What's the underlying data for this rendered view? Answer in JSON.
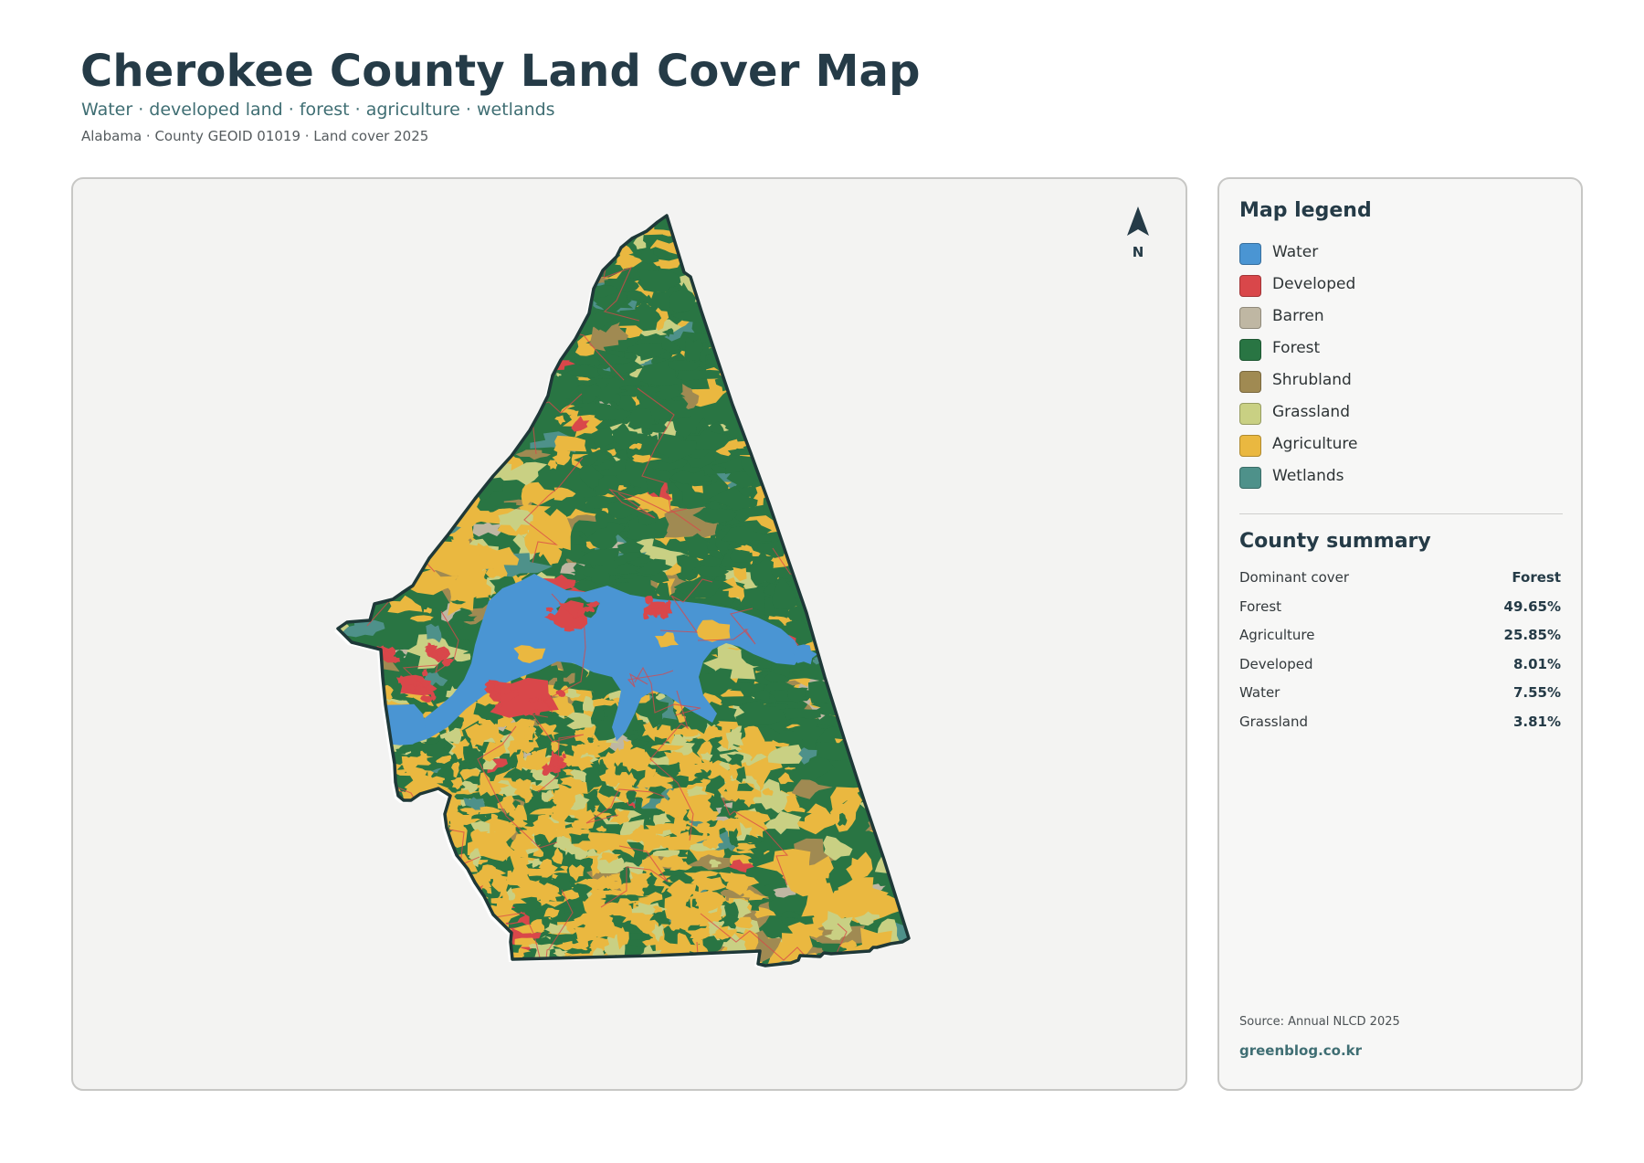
{
  "header": {
    "title": "Cherokee County Land Cover Map",
    "subtitle": "Water · developed land · forest · agriculture · wetlands",
    "meta": "Alabama · County GEOID 01019 · Land cover 2025"
  },
  "map": {
    "north_label": "N",
    "colors": {
      "water": "#4a95d3",
      "developed": "#d9474a",
      "barren": "#bfb7a3",
      "forest": "#297543",
      "shrubland": "#a08a52",
      "grassland": "#c9d083",
      "agriculture": "#eab840",
      "wetlands": "#4e918a",
      "outline": "#1e3838",
      "panel_bg": "#f3f3f2"
    }
  },
  "legend": {
    "title": "Map legend",
    "items": [
      {
        "label": "Water",
        "color": "#4a95d3"
      },
      {
        "label": "Developed",
        "color": "#d9474a"
      },
      {
        "label": "Barren",
        "color": "#bfb7a3"
      },
      {
        "label": "Forest",
        "color": "#297543"
      },
      {
        "label": "Shrubland",
        "color": "#a08a52"
      },
      {
        "label": "Grassland",
        "color": "#c9d083"
      },
      {
        "label": "Agriculture",
        "color": "#eab840"
      },
      {
        "label": "Wetlands",
        "color": "#4e918a"
      }
    ]
  },
  "summary": {
    "title": "County summary",
    "rows": [
      {
        "key": "Dominant cover",
        "value": "Forest"
      },
      {
        "key": "Forest",
        "value": "49.65%"
      },
      {
        "key": "Agriculture",
        "value": "25.85%"
      },
      {
        "key": "Developed",
        "value": "8.01%"
      },
      {
        "key": "Water",
        "value": "7.55%"
      },
      {
        "key": "Grassland",
        "value": "3.81%"
      }
    ]
  },
  "footer": {
    "source": "Source: Annual NLCD 2025",
    "brand": "greenblog.co.kr"
  }
}
